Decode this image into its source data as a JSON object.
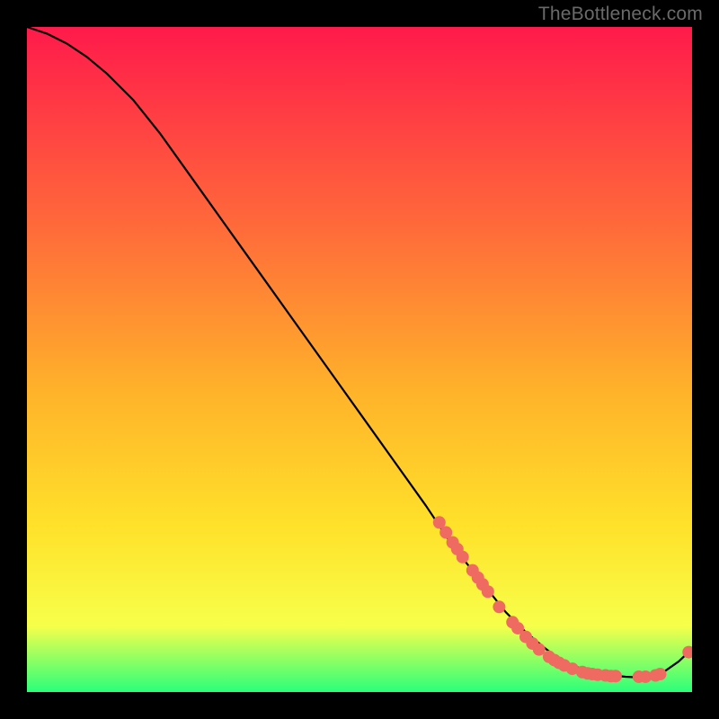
{
  "watermark": "TheBottleneck.com",
  "colors": {
    "grad_top": "#ff1a4b",
    "grad_mid1": "#ff6a3a",
    "grad_mid2": "#ffb32a",
    "grad_mid3": "#ffe12a",
    "grad_mid4": "#f7ff4a",
    "grad_bottom": "#2aff7a",
    "curve": "#000000",
    "marker": "#ef6a61",
    "bg": "#000000"
  },
  "chart_data": {
    "type": "line",
    "title": "",
    "xlabel": "",
    "ylabel": "",
    "xlim": [
      0,
      100
    ],
    "ylim": [
      0,
      100
    ],
    "curve": {
      "x": [
        0,
        3,
        6,
        9,
        12,
        16,
        20,
        25,
        30,
        35,
        40,
        45,
        50,
        55,
        60,
        64,
        68,
        72,
        75,
        78,
        80,
        82,
        84,
        86,
        88,
        90,
        92,
        94,
        96,
        98,
        100
      ],
      "y": [
        100,
        99,
        97.5,
        95.5,
        93,
        89,
        84,
        77,
        70,
        63,
        56,
        49,
        42,
        35,
        28,
        22,
        17,
        12,
        9,
        6.5,
        5,
        4,
        3.3,
        2.8,
        2.5,
        2.3,
        2.2,
        2.4,
        3.2,
        4.6,
        6.5
      ]
    },
    "markers": [
      {
        "x": 62,
        "y": 25.5
      },
      {
        "x": 63,
        "y": 24
      },
      {
        "x": 64,
        "y": 22.5
      },
      {
        "x": 64.7,
        "y": 21.5
      },
      {
        "x": 65.5,
        "y": 20.3
      },
      {
        "x": 67,
        "y": 18.3
      },
      {
        "x": 67.8,
        "y": 17.2
      },
      {
        "x": 68.5,
        "y": 16.2
      },
      {
        "x": 69.3,
        "y": 15.1
      },
      {
        "x": 71,
        "y": 12.8
      },
      {
        "x": 73,
        "y": 10.5
      },
      {
        "x": 73.8,
        "y": 9.6
      },
      {
        "x": 75,
        "y": 8.3
      },
      {
        "x": 76,
        "y": 7.3
      },
      {
        "x": 77,
        "y": 6.4
      },
      {
        "x": 78.5,
        "y": 5.3
      },
      {
        "x": 79.3,
        "y": 4.8
      },
      {
        "x": 80,
        "y": 4.4
      },
      {
        "x": 80.8,
        "y": 4.0
      },
      {
        "x": 82,
        "y": 3.5
      },
      {
        "x": 83.5,
        "y": 3.0
      },
      {
        "x": 84.3,
        "y": 2.8
      },
      {
        "x": 85,
        "y": 2.7
      },
      {
        "x": 85.8,
        "y": 2.6
      },
      {
        "x": 87,
        "y": 2.5
      },
      {
        "x": 87.8,
        "y": 2.4
      },
      {
        "x": 88.5,
        "y": 2.4
      },
      {
        "x": 92,
        "y": 2.3
      },
      {
        "x": 93,
        "y": 2.3
      },
      {
        "x": 94.5,
        "y": 2.5
      },
      {
        "x": 95.2,
        "y": 2.7
      },
      {
        "x": 99.5,
        "y": 6.0
      }
    ]
  }
}
